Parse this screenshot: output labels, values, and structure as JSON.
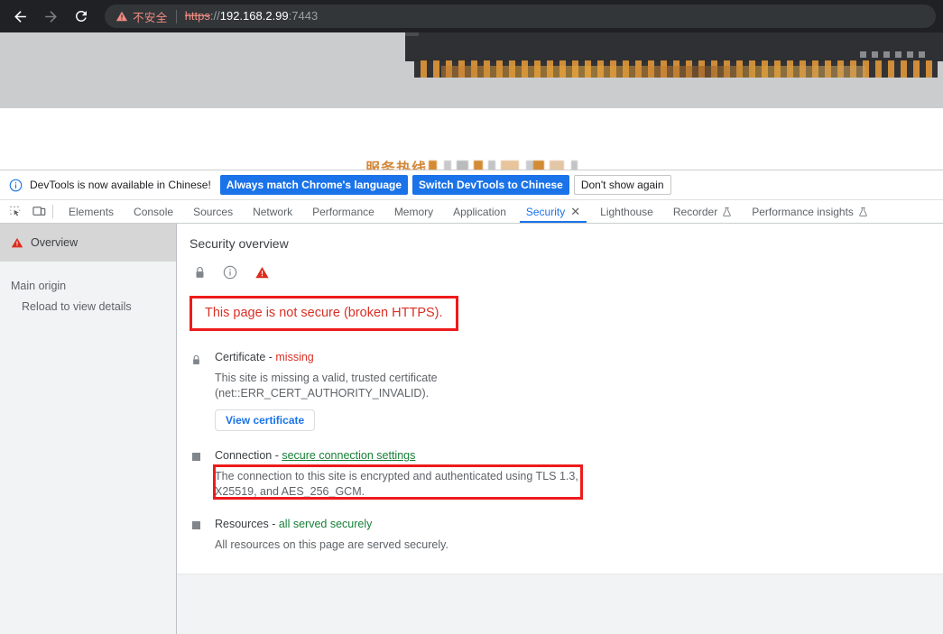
{
  "browser": {
    "nav": {
      "back_label": "Back",
      "forward_label": "Forward",
      "reload_label": "Reload"
    },
    "omnibox": {
      "security_warning": "不安全",
      "url_scheme": "https",
      "url_separator": "://",
      "url_host": "192.168.2.99",
      "url_port": ":7443"
    }
  },
  "page": {
    "hotline_label": "服务热线",
    "hotline_value_redacted": true
  },
  "devtools": {
    "i18n_bar": {
      "message": "DevTools is now available in Chinese!",
      "primary_button": "Always match Chrome's language",
      "secondary_button": "Switch DevTools to Chinese",
      "dismiss_button": "Don't show again"
    },
    "tabs": [
      {
        "label": "Elements",
        "active": false,
        "closable": false,
        "experimental": false
      },
      {
        "label": "Console",
        "active": false,
        "closable": false,
        "experimental": false
      },
      {
        "label": "Sources",
        "active": false,
        "closable": false,
        "experimental": false
      },
      {
        "label": "Network",
        "active": false,
        "closable": false,
        "experimental": false
      },
      {
        "label": "Performance",
        "active": false,
        "closable": false,
        "experimental": false
      },
      {
        "label": "Memory",
        "active": false,
        "closable": false,
        "experimental": false
      },
      {
        "label": "Application",
        "active": false,
        "closable": false,
        "experimental": false
      },
      {
        "label": "Security",
        "active": true,
        "closable": true,
        "experimental": false
      },
      {
        "label": "Lighthouse",
        "active": false,
        "closable": false,
        "experimental": false
      },
      {
        "label": "Recorder",
        "active": false,
        "closable": false,
        "experimental": true
      },
      {
        "label": "Performance insights",
        "active": false,
        "closable": false,
        "experimental": true
      }
    ],
    "sidebar": {
      "overview_label": "Overview",
      "group_title": "Main origin",
      "subitem_label": "Reload to view details"
    },
    "main": {
      "title": "Security overview",
      "icons": [
        "lock-icon",
        "info-icon",
        "warning-triangle-icon"
      ],
      "summary": "This page is not secure (broken HTTPS).",
      "sections": [
        {
          "id": "certificate",
          "icon": "lock-icon",
          "head_label": "Certificate - ",
          "head_state": "missing",
          "head_state_kind": "bad",
          "description": "This site is missing a valid, trusted certificate (net::ERR_CERT_AUTHORITY_INVALID).",
          "button": "View certificate"
        },
        {
          "id": "connection",
          "icon": "square-icon",
          "head_label": "Connection - ",
          "head_state": "secure connection settings",
          "head_state_kind": "link",
          "description": "The connection to this site is encrypted and authenticated using TLS 1.3, X25519, and AES_256_GCM.",
          "button": null
        },
        {
          "id": "resources",
          "icon": "square-icon",
          "head_label": "Resources - ",
          "head_state": "all served securely",
          "head_state_kind": "good",
          "description": "All resources on this page are served securely.",
          "button": null
        }
      ]
    }
  },
  "colors": {
    "toolbar_bg": "#202124",
    "omnibox_bg": "#323639",
    "warning_red": "#d93025",
    "annotation_red": "#ee1b1b",
    "accent_blue": "#1a73e8",
    "good_green": "#178038",
    "hotline_orange": "#d2883a",
    "sidebar_bg": "#f1f3f4",
    "sidebar_selected_bg": "#d6d6d6"
  }
}
